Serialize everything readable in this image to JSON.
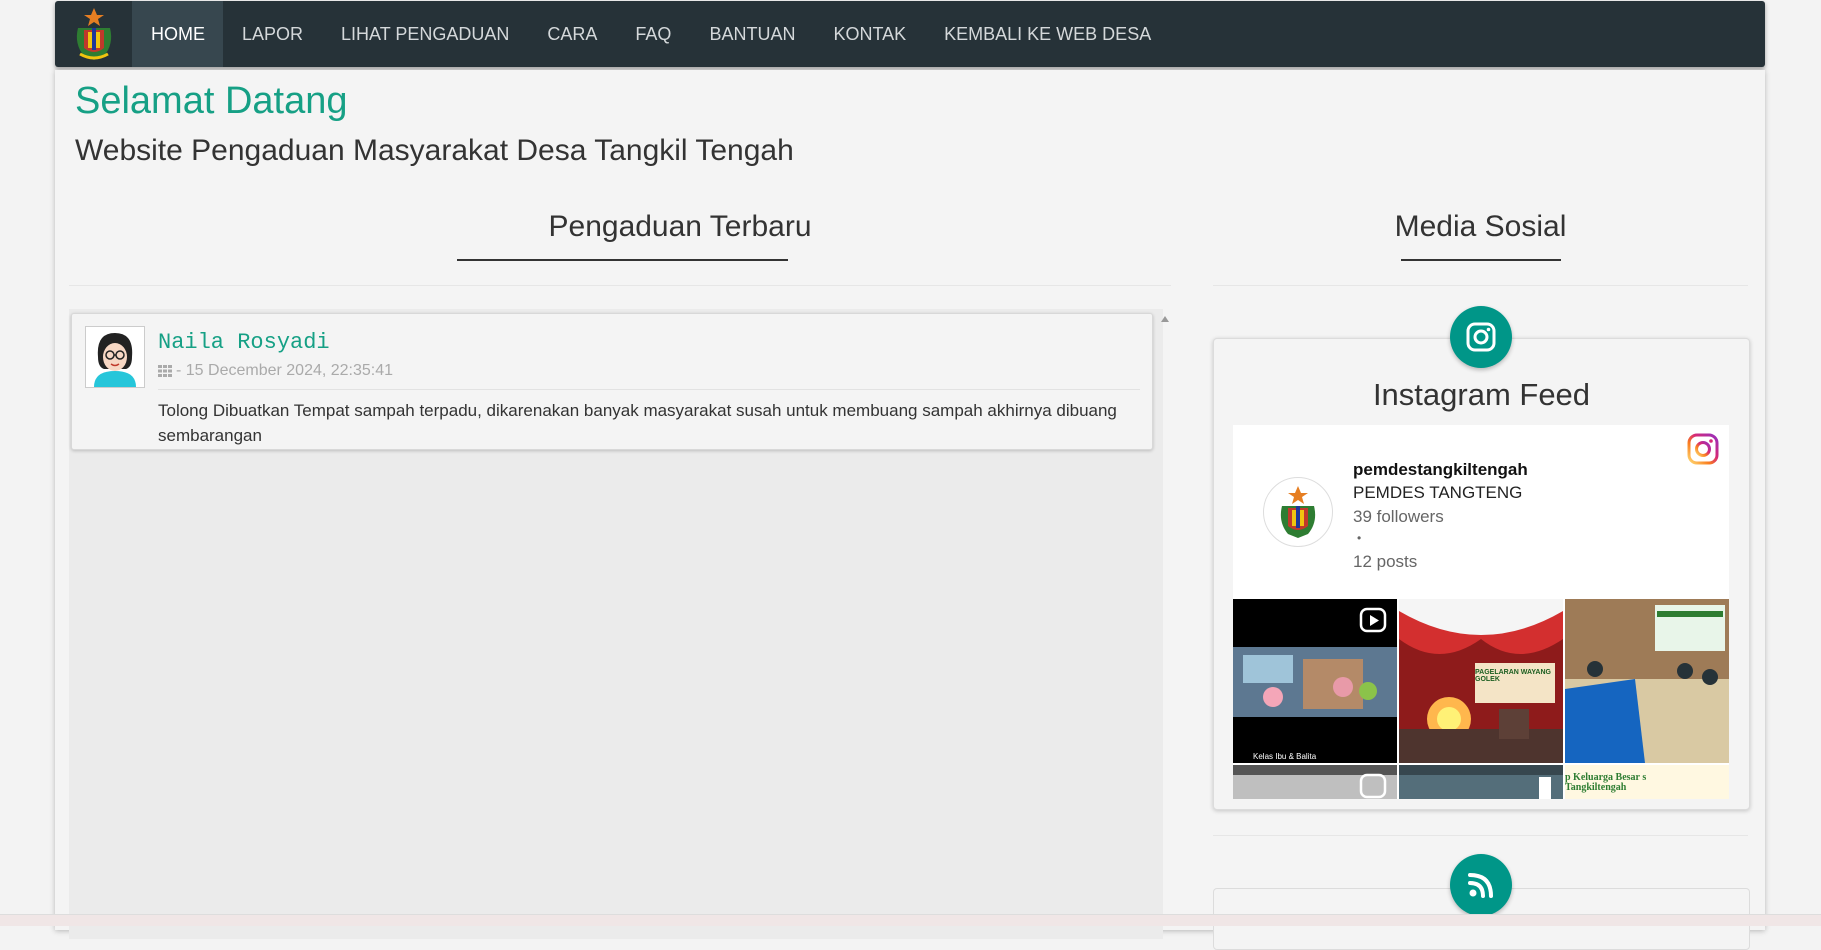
{
  "nav": {
    "items": [
      {
        "label": "HOME",
        "active": true
      },
      {
        "label": "LAPOR"
      },
      {
        "label": "LIHAT PENGADUAN"
      },
      {
        "label": "CARA"
      },
      {
        "label": "FAQ"
      },
      {
        "label": "BANTUAN"
      },
      {
        "label": "KONTAK"
      },
      {
        "label": "KEMBALI KE WEB DESA"
      }
    ]
  },
  "hero": {
    "title": "Selamat Datang",
    "subtitle": "Website Pengaduan Masyarakat Desa Tangkil Tengah"
  },
  "latest": {
    "heading": "Pengaduan Terbaru",
    "reports": [
      {
        "name": "Naila Rosyadi",
        "date": "- 15 December 2024, 22:35:41",
        "text": "Tolong Dibuatkan Tempat sampah terpadu, dikarenakan banyak masyarakat susah untuk membuang sampah akhirnya dibuang sembarangan"
      }
    ]
  },
  "social": {
    "heading": "Media Sosial",
    "feed_title": "Instagram Feed",
    "profile": {
      "username": "pemdestangkiltengah",
      "full_name": "PEMDES TANGTENG",
      "followers": "39 followers",
      "separator": "•",
      "posts": "12 posts"
    },
    "thumbs": [
      {
        "caption": "Kelas Ibu & Balita"
      },
      {
        "caption": "PAGELARAN WAYANG GOLEK"
      },
      {
        "caption": ""
      },
      {
        "caption": ""
      },
      {
        "caption": ""
      },
      {
        "caption": "p Keluarga Besar s Tangkiltengah"
      }
    ]
  },
  "colors": {
    "accent": "#16a085",
    "nav_bg": "#263238",
    "circle": "#009688"
  }
}
